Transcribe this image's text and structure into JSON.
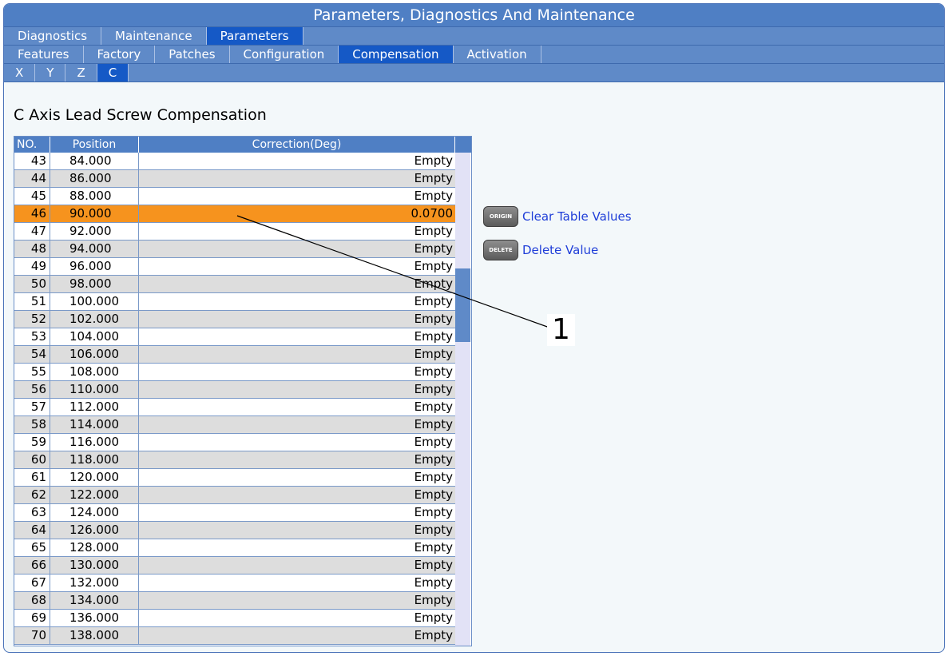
{
  "window": {
    "title": "Parameters, Diagnostics And Maintenance"
  },
  "tabs_level1": [
    "Diagnostics",
    "Maintenance",
    "Parameters"
  ],
  "tabs_level1_active": "Parameters",
  "tabs_level2": [
    "Features",
    "Factory",
    "Patches",
    "Configuration",
    "Compensation",
    "Activation"
  ],
  "tabs_level2_active": "Compensation",
  "tabs_axis": [
    "X",
    "Y",
    "Z",
    "C"
  ],
  "tabs_axis_active": "C",
  "heading": "C Axis Lead Screw Compensation",
  "table": {
    "columns": [
      "NO.",
      "Position",
      "Correction(Deg)"
    ],
    "selected_no": "46",
    "rows": [
      {
        "no": "43",
        "position": "84.000",
        "correction": "Empty"
      },
      {
        "no": "44",
        "position": "86.000",
        "correction": "Empty"
      },
      {
        "no": "45",
        "position": "88.000",
        "correction": "Empty"
      },
      {
        "no": "46",
        "position": "90.000",
        "correction": "0.0700"
      },
      {
        "no": "47",
        "position": "92.000",
        "correction": "Empty"
      },
      {
        "no": "48",
        "position": "94.000",
        "correction": "Empty"
      },
      {
        "no": "49",
        "position": "96.000",
        "correction": "Empty"
      },
      {
        "no": "50",
        "position": "98.000",
        "correction": "Empty"
      },
      {
        "no": "51",
        "position": "100.000",
        "correction": "Empty"
      },
      {
        "no": "52",
        "position": "102.000",
        "correction": "Empty"
      },
      {
        "no": "53",
        "position": "104.000",
        "correction": "Empty"
      },
      {
        "no": "54",
        "position": "106.000",
        "correction": "Empty"
      },
      {
        "no": "55",
        "position": "108.000",
        "correction": "Empty"
      },
      {
        "no": "56",
        "position": "110.000",
        "correction": "Empty"
      },
      {
        "no": "57",
        "position": "112.000",
        "correction": "Empty"
      },
      {
        "no": "58",
        "position": "114.000",
        "correction": "Empty"
      },
      {
        "no": "59",
        "position": "116.000",
        "correction": "Empty"
      },
      {
        "no": "60",
        "position": "118.000",
        "correction": "Empty"
      },
      {
        "no": "61",
        "position": "120.000",
        "correction": "Empty"
      },
      {
        "no": "62",
        "position": "122.000",
        "correction": "Empty"
      },
      {
        "no": "63",
        "position": "124.000",
        "correction": "Empty"
      },
      {
        "no": "64",
        "position": "126.000",
        "correction": "Empty"
      },
      {
        "no": "65",
        "position": "128.000",
        "correction": "Empty"
      },
      {
        "no": "66",
        "position": "130.000",
        "correction": "Empty"
      },
      {
        "no": "67",
        "position": "132.000",
        "correction": "Empty"
      },
      {
        "no": "68",
        "position": "134.000",
        "correction": "Empty"
      },
      {
        "no": "69",
        "position": "136.000",
        "correction": "Empty"
      },
      {
        "no": "70",
        "position": "138.000",
        "correction": "Empty"
      }
    ]
  },
  "actions": [
    {
      "key": "ORIGIN",
      "label": "Clear Table Values"
    },
    {
      "key": "DELETE",
      "label": "Delete Value"
    }
  ],
  "callout": {
    "number": "1"
  },
  "colors": {
    "accent": "#4f7fc4",
    "active_tab": "#1559c6",
    "selected_row": "#f6931e",
    "link": "#1f3ed8"
  }
}
